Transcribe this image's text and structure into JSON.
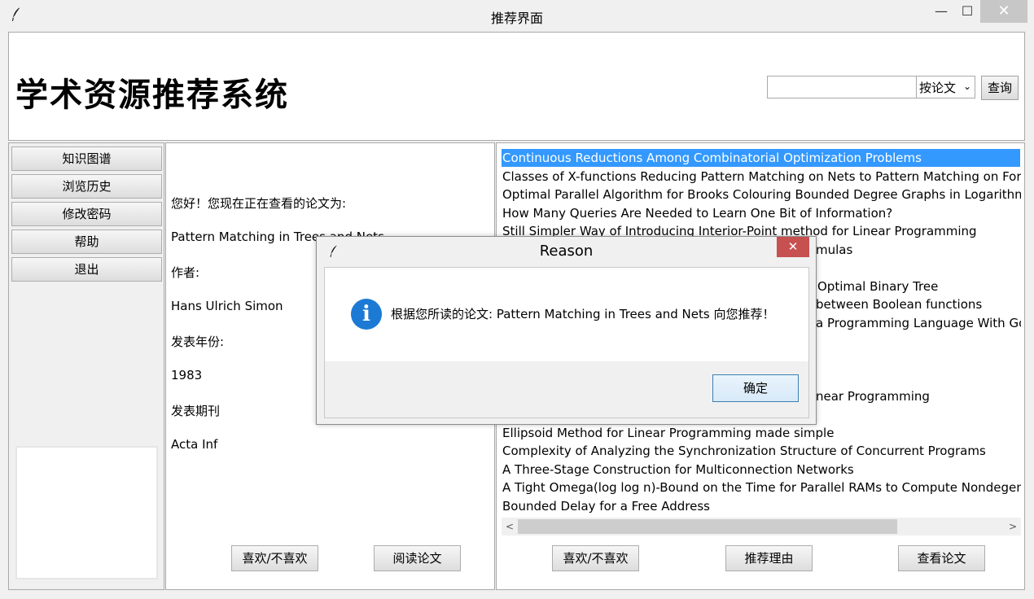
{
  "window": {
    "title": "推荐界面",
    "minimize": "—",
    "maximize": "☐",
    "close": "✕"
  },
  "header": {
    "app_title": "学术资源推荐系统",
    "search": {
      "value": "",
      "placeholder": "",
      "mode": "按论文",
      "button": "查询"
    }
  },
  "sidebar": {
    "items": [
      "知识图谱",
      "浏览历史",
      "修改密码",
      "帮助",
      "退出"
    ]
  },
  "paper": {
    "greeting": "您好！您现在正在查看的论文为:",
    "title": "Pattern Matching in Trees and Nets",
    "author_label": "作者:",
    "author": "Hans Ulrich Simon",
    "year_label": "发表年份:",
    "year": "1983",
    "journal_label": "发表期刊",
    "journal": "Acta Inf",
    "like_button": "喜欢/不喜欢",
    "read_button": "阅读论文"
  },
  "recommendations": {
    "items": [
      "Continuous Reductions Among Combinatorial Optimization Problems",
      "Classes of X-functions Reducing Pattern Matching on Nets to Pattern Matching on Forests",
      "Optimal Parallel Algorithm for Brooks Colouring Bounded Degree Graphs in Logarithmic Time",
      "How Many Queries Are Needed to Learn One Bit of Information?",
      "Still Simpler Way of Introducing Interior-Point method for Linear Programming",
      "mulas",
      "",
      "Optimal Binary Tree",
      "between Boolean functions",
      "a Programming Language With Go",
      "",
      "",
      "near Programming",
      "",
      "Ellipsoid Method for Linear Programming made simple",
      "Complexity of Analyzing the Synchronization Structure of Concurrent Programs",
      "A Three-Stage Construction for Multiconnection Networks",
      "A Tight Omega(log log n)-Bound on the Time for Parallel RAMs to Compute Nondegenerate",
      "Bounded Delay for a Free Address"
    ],
    "selected_index": 0,
    "like_button": "喜欢/不喜欢",
    "reason_button": "推荐理由",
    "view_button": "查看论文",
    "scroll_left": "<",
    "scroll_right": ">"
  },
  "dialog": {
    "title": "Reason",
    "close": "✕",
    "info_glyph": "i",
    "message": "根据您所读的论文: Pattern Matching in Trees and Nets 向您推荐！",
    "ok_button": "确定"
  },
  "colors": {
    "selection": "#3399ff",
    "info_icon": "#1c7ad4",
    "dialog_close": "#c75050"
  }
}
